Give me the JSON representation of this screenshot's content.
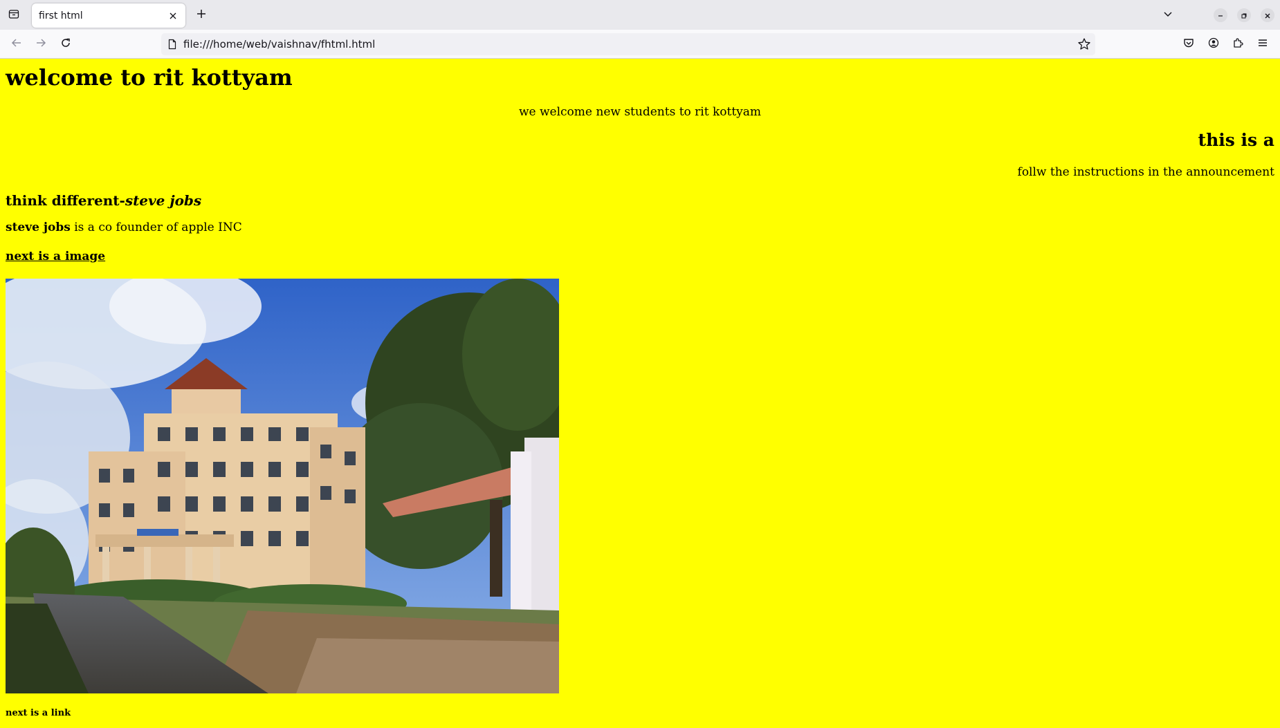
{
  "browser": {
    "tab_title": "first html",
    "url": "file:///home/web/vaishnav/fhtml.html"
  },
  "page": {
    "background_color": "#ffff00",
    "heading_main": "welcome to rit kottyam",
    "welcome_text": "we welcome new students to rit kottyam",
    "right_heading": "this is a",
    "right_text": "follw the instructions in the announcement",
    "quote_prefix": "think different-",
    "quote_author": "steve jobs",
    "bio_name": "steve jobs",
    "bio_rest": " is a co founder of apple INC",
    "next_image_label": "next is a image",
    "next_link_label": "next is a link"
  },
  "icons": {
    "tab_list": "tab-list-icon",
    "tab_close": "close-icon",
    "new_tab": "plus-icon",
    "tabs_menu": "chevron-down-icon",
    "back": "arrow-left-icon",
    "forward": "arrow-right-icon",
    "reload": "reload-icon",
    "page": "page-icon",
    "bookmark": "star-icon",
    "pocket": "pocket-icon",
    "account": "account-icon",
    "extensions": "puzzle-icon",
    "menu": "hamburger-icon",
    "minimize": "minimize-icon",
    "restore": "restore-icon",
    "close_window": "close-window-icon"
  }
}
